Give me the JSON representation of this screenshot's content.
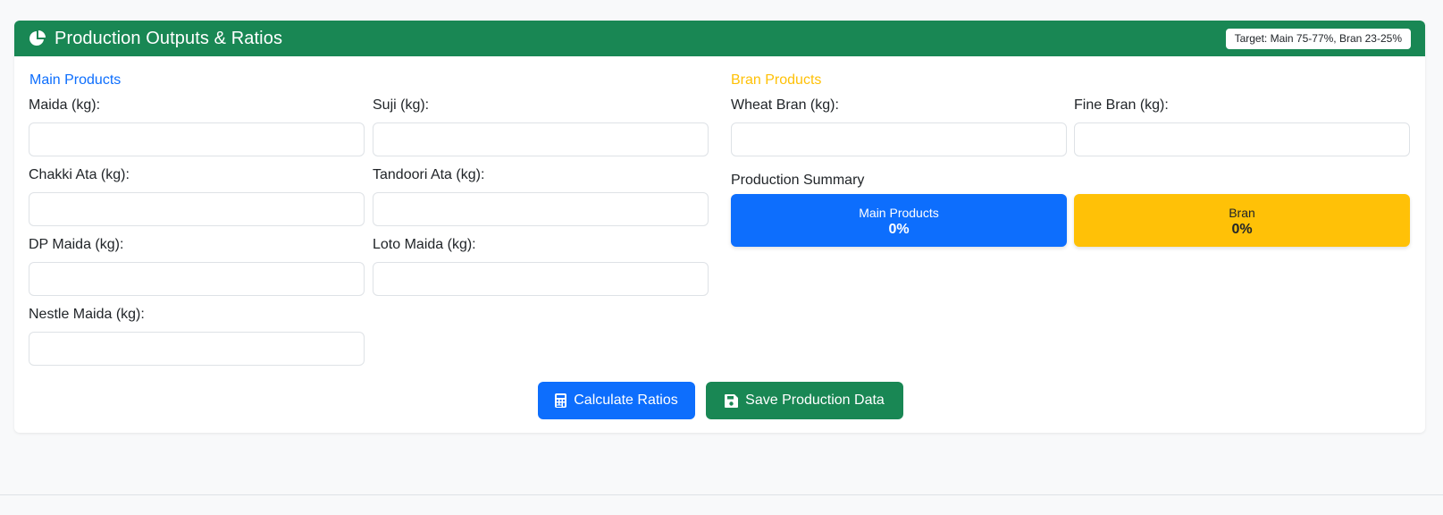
{
  "header": {
    "title": "Production Outputs & Ratios",
    "icon": "pie-chart-icon",
    "target_badge": "Target: Main 75-77%, Bran 23-25%",
    "color": "#198754"
  },
  "main_products": {
    "title": "Main Products",
    "fields": {
      "maida": {
        "label": "Maida (kg):",
        "value": ""
      },
      "suji": {
        "label": "Suji (kg):",
        "value": ""
      },
      "chakki_ata": {
        "label": "Chakki Ata (kg):",
        "value": ""
      },
      "tandoori_ata": {
        "label": "Tandoori Ata (kg):",
        "value": ""
      },
      "dp_maida": {
        "label": "DP Maida (kg):",
        "value": ""
      },
      "loto_maida": {
        "label": "Loto Maida (kg):",
        "value": ""
      },
      "nestle_maida": {
        "label": "Nestle Maida (kg):",
        "value": ""
      }
    }
  },
  "bran_products": {
    "title": "Bran Products",
    "fields": {
      "wheat_bran": {
        "label": "Wheat Bran (kg):",
        "value": ""
      },
      "fine_bran": {
        "label": "Fine Bran (kg):",
        "value": ""
      }
    }
  },
  "summary": {
    "title": "Production Summary",
    "main": {
      "label": "Main Products",
      "value": "0%",
      "color": "#0d6efd"
    },
    "bran": {
      "label": "Bran",
      "value": "0%",
      "color": "#ffc107"
    }
  },
  "actions": {
    "calculate": {
      "label": "Calculate Ratios",
      "icon": "calculator-icon",
      "color": "#0d6efd"
    },
    "save": {
      "label": "Save Production Data",
      "icon": "save-icon",
      "color": "#198754"
    }
  }
}
